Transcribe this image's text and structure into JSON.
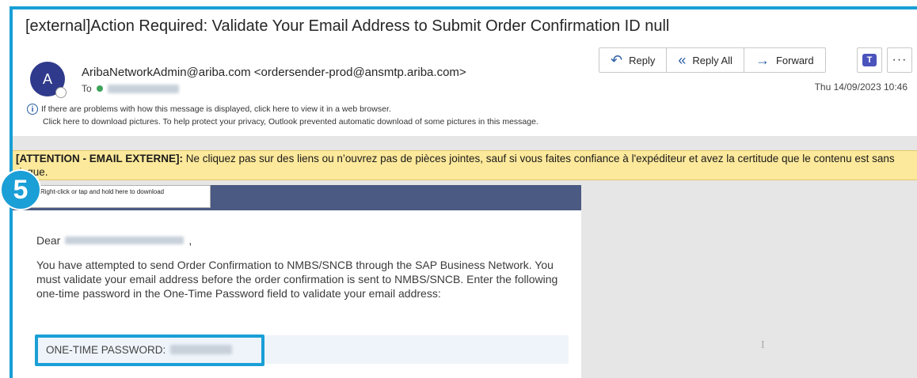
{
  "email": {
    "subject": "[external]Action Required: Validate Your Email Address to Submit Order Confirmation ID null",
    "avatar_initial": "A",
    "sender": "AribaNetworkAdmin@ariba.com <ordersender-prod@ansmtp.ariba.com>",
    "to_label": "To",
    "date": "Thu 14/09/2023 10:46",
    "info_line1": "If there are problems with how this message is displayed, click here to view it in a web browser.",
    "info_line2": "Click here to download pictures. To help protect your privacy, Outlook prevented automatic download of some pictures in this message."
  },
  "actions": {
    "reply": "Reply",
    "reply_all": "Reply All",
    "forward": "Forward",
    "more": "···"
  },
  "banner": {
    "bold": "[ATTENTION - EMAIL EXTERNE]:",
    "text": " Ne cliquez pas sur des liens ou n’ouvrez pas de pièces jointes, sauf si vous faites confiance à l'expéditeur et avez la certitude que le contenu est sans risque."
  },
  "body": {
    "image_placeholder": "Right-click or tap and hold here to download",
    "dear": "Dear",
    "comma": ",",
    "paragraph": "You have attempted to send Order Confirmation to NMBS/SNCB through the SAP Business Network. You must validate your email address before the order confirmation is sent to NMBS/SNCB. Enter the following one-time password in the One-Time Password field to validate your email address:",
    "otp_label": "ONE-TIME PASSWORD:"
  },
  "step_badge": "5",
  "colors": {
    "highlight": "#1a9fd6",
    "banner_bg": "#fde99b",
    "header_bar": "#4b5a82",
    "avatar": "#2f3a8c"
  }
}
